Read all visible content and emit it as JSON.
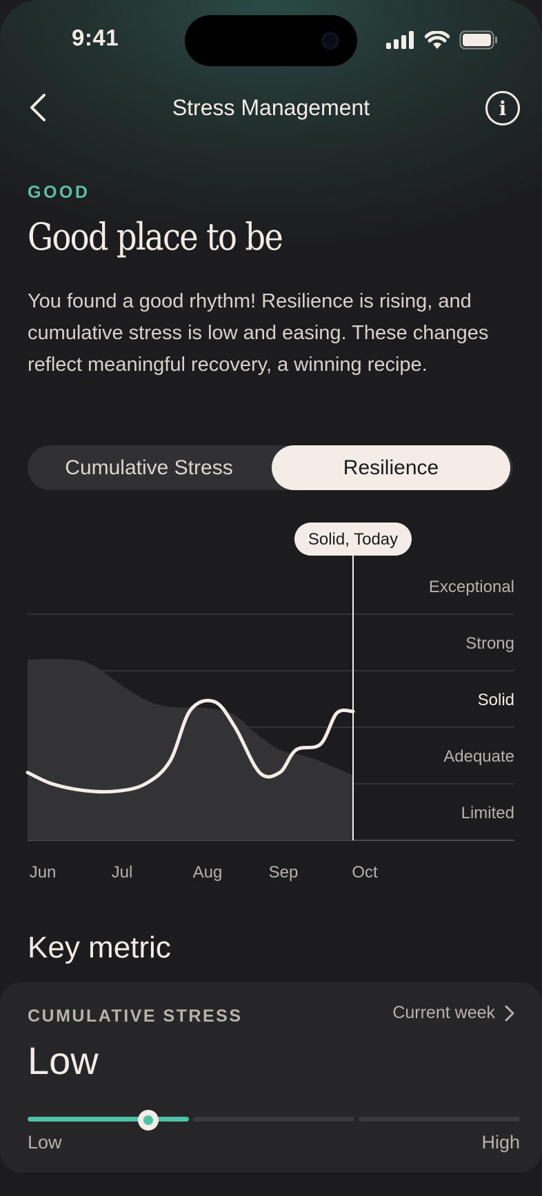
{
  "status_bar": {
    "time": "9:41"
  },
  "nav": {
    "title": "Stress Management"
  },
  "summary": {
    "label": "GOOD",
    "headline": "Good place to be",
    "description": "You found a good rhythm! Resilience is rising, and cumulative stress is low and easing. These changes reflect meaningful recovery, a winning recipe."
  },
  "toggle": {
    "options": [
      "Cumulative Stress",
      "Resilience"
    ],
    "selected": "Resilience"
  },
  "chart_data": {
    "type": "line",
    "x_ticks": [
      "Jun",
      "Jul",
      "Aug",
      "Sep",
      "Oct"
    ],
    "y_levels": [
      "Exceptional",
      "Strong",
      "Solid",
      "Adequate",
      "Limited"
    ],
    "highlighted_level": "Solid",
    "tooltip": "Solid, Today",
    "series": [
      {
        "role": "resilience-line",
        "x": [
          0,
          0.3,
          0.7,
          1.1,
          1.45,
          1.75,
          2.0,
          2.3,
          2.55,
          2.85,
          3.1,
          3.3,
          3.6,
          3.8,
          4.0
        ],
        "y": [
          1.2,
          1.0,
          0.88,
          0.87,
          1.0,
          1.4,
          2.3,
          2.45,
          2.0,
          1.2,
          1.2,
          1.6,
          1.7,
          2.25,
          2.28
        ]
      },
      {
        "role": "cumulative-stress-area",
        "x": [
          0,
          0.5,
          0.8,
          1.2,
          1.5,
          1.8,
          2.1,
          2.5,
          2.8,
          3.1,
          3.5,
          4.0
        ],
        "y": [
          3.2,
          3.2,
          3.1,
          2.7,
          2.45,
          2.35,
          2.35,
          2.25,
          1.9,
          1.6,
          1.45,
          1.15
        ]
      }
    ]
  },
  "key_metric": {
    "section_title": "Key metric",
    "label": "CUMULATIVE STRESS",
    "period": "Current week",
    "value": "Low",
    "level_fraction": 0.245,
    "scale_low": "Low",
    "scale_high": "High",
    "accent_color": "#4cc3a6"
  },
  "colors": {
    "accent": "#5fbfa5",
    "background": "#1c1c1e",
    "foreground": "#f3ece7"
  }
}
